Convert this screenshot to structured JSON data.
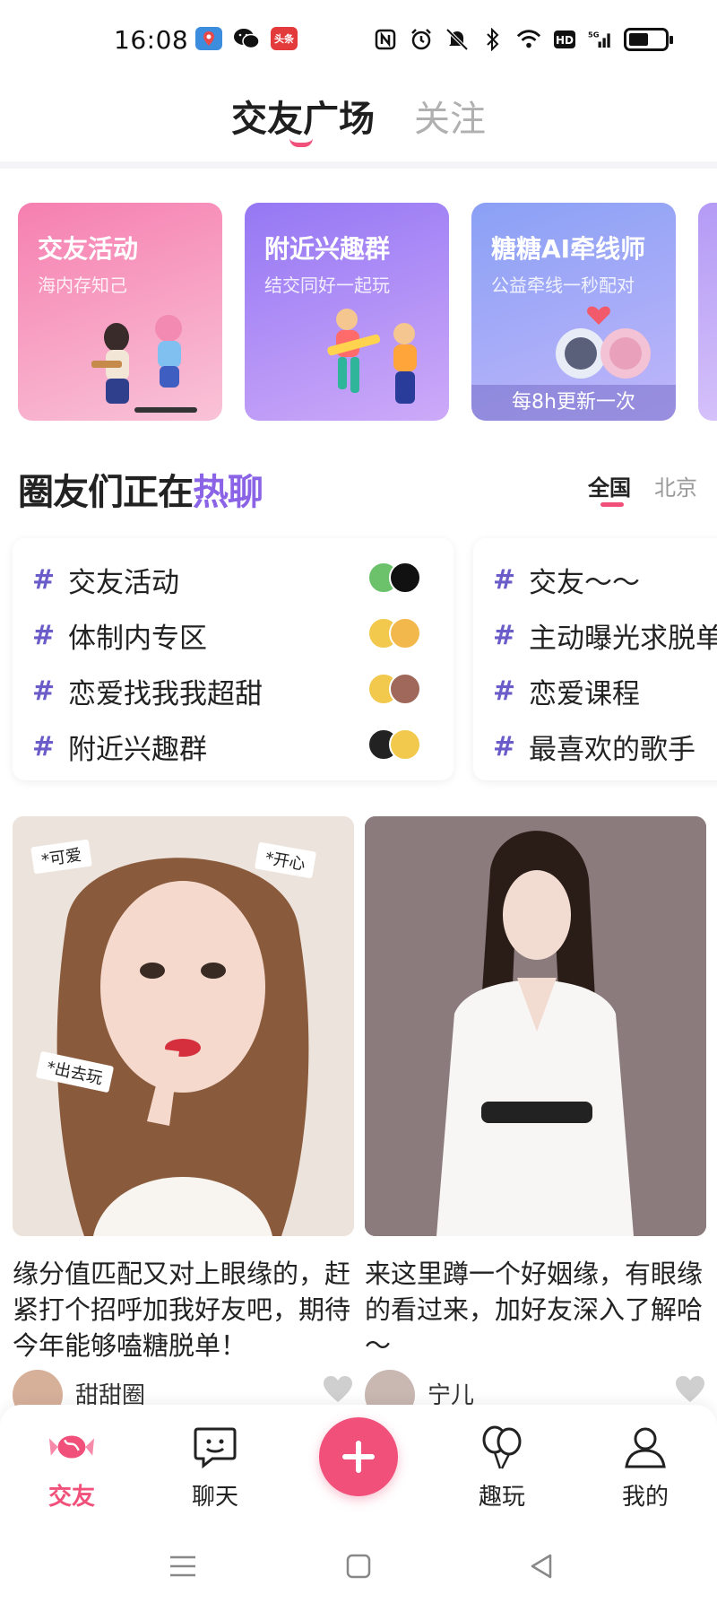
{
  "status_bar": {
    "time": "16:08",
    "apps": [
      {
        "icon": "map-app-icon",
        "color": "#3c8dde"
      },
      {
        "icon": "wechat-icon",
        "color": "#111111"
      },
      {
        "icon": "toutiao-icon",
        "label": "头条",
        "color": "#e33b3b"
      }
    ],
    "battery_level": 0.55
  },
  "top_tabs": {
    "active": "交友广场",
    "inactive": "关注"
  },
  "feature_cards": [
    {
      "title": "交友活动",
      "subtitle": "海内存知己",
      "colors": [
        "#f67fb0",
        "#f9b7cf"
      ]
    },
    {
      "title": "附近兴趣群",
      "subtitle": "结交同好一起玩",
      "colors": [
        "#9b7cf5",
        "#c7a6f8"
      ]
    },
    {
      "title": "糖糖AI牵线师",
      "subtitle": "公益牵线一秒配对",
      "footer": "每8h更新一次",
      "colors": [
        "#8aa0f5",
        "#b6b4fa"
      ]
    }
  ],
  "hot_section": {
    "title_plain": "圈友们正在",
    "title_highlight": "热聊",
    "region_tabs": {
      "active": "全国",
      "inactive": "北京"
    }
  },
  "topic_cards": [
    {
      "items": [
        {
          "hash": "#",
          "label": "交友活动"
        },
        {
          "hash": "#",
          "label": "体制内专区"
        },
        {
          "hash": "#",
          "label": "恋爱找我我超甜"
        },
        {
          "hash": "#",
          "label": "附近兴趣群"
        }
      ]
    },
    {
      "items": [
        {
          "hash": "#",
          "label": "交友～～"
        },
        {
          "hash": "#",
          "label": "主动曝光求脱单"
        },
        {
          "hash": "#",
          "label": "恋爱课程"
        },
        {
          "hash": "#",
          "label": "最喜欢的歌手"
        }
      ]
    }
  ],
  "posts": [
    {
      "stickers": [
        "*可爱",
        "*开心",
        "*出去玩"
      ],
      "text": "缘分值匹配又对上眼缘的，赶紧打个招呼加我好友吧，期待今年能够嗑糖脱单！",
      "author": "甜甜圈"
    },
    {
      "text": "来这里蹲一个好姻缘，有眼缘的看过来，加好友深入了解哈～",
      "author": "宁儿"
    }
  ],
  "bottom_nav": {
    "items": [
      {
        "label": "交友",
        "icon": "candy-icon",
        "active": true
      },
      {
        "label": "聊天",
        "icon": "chat-bubble-icon",
        "active": false
      },
      {
        "label": "趣玩",
        "icon": "balloons-icon",
        "active": false
      },
      {
        "label": "我的",
        "icon": "profile-icon",
        "active": false
      }
    ],
    "center_icon": "plus-icon"
  },
  "colors": {
    "accent": "#f0507a",
    "topic_hash": "#6a5cc9",
    "highlight": "#8a63e6"
  }
}
